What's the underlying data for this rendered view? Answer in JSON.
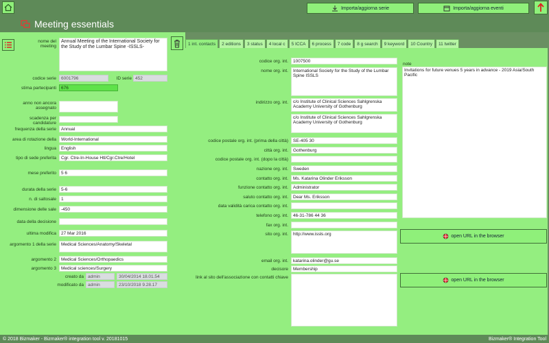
{
  "header": {
    "title": "Meeting essentials",
    "import_series": "Importa/aggiorna serie",
    "import_events": "Importa/aggiorna eventi"
  },
  "left": {
    "meeting_name_label": "nome del meeting",
    "meeting_name": "Annual Meeting of the International Society for the Study of the Lumbar Spine -ISSLS-",
    "series_code_label": "codice serie",
    "series_code": "6001796",
    "series_id_label": "ID serie",
    "series_id": "452",
    "estimate_label": "stima partecipanti",
    "estimate": "676",
    "year_not_assigned_label": "anno non ancora assegnato",
    "year_not_assigned": "",
    "candidature_label": "scadenza per candidature",
    "candidature": "",
    "frequency_label": "frequenza della serie",
    "frequency": "Annual",
    "rotation_label": "area di rotazione della",
    "rotation": "World-International",
    "language_label": "lingua",
    "language": "English",
    "venue_type_label": "tipo di sede preferita",
    "venue_type": "Cgr. Ctre-In-House Htl/Cgr.Ctre/Hotel",
    "month_label": "mese preferito",
    "month": "5 6",
    "duration_label": "durata della serie",
    "duration": "5-6",
    "halls_label": "n. di saltosale",
    "halls": "1",
    "hall_size_label": "dimensione delle sale",
    "hall_size": "-450",
    "decision_date_label": "data della decisione",
    "decision_date": "",
    "last_modified_label": "ultima modifica",
    "last_modified": "27 Mar 2016",
    "topic1_label": "argomento 1 della serie",
    "topic1": "Medical Sciences/Anatomy/Skeletal",
    "topic2_label": "argomento 2",
    "topic2": "Medical Sciences/Orthopaedics",
    "topic3_label": "argomento 3",
    "topic3": "Medical sciences/Surgery",
    "created_label": "creato da",
    "created_by": "admin",
    "created_at": "30/04/2014 18.01.54",
    "modified_label": "modificato da",
    "modified_by": "admin",
    "modified_at": "23/10/2018 9.28.17"
  },
  "tabs": [
    "1 int. contacts",
    "2 editions",
    "3 status",
    "4 local c",
    "5 ICCA",
    "6 process",
    "7 code",
    "8 g search",
    "9 keyword",
    "10 Country",
    "11 twitter"
  ],
  "contacts": {
    "org_code_label": "codice org. int.",
    "org_code": "1007500",
    "org_name_label": "nome org. int.",
    "org_name": "International Society for the Study of the Lumbar Spine ISSLS",
    "address_label": "indirizzo org. int.",
    "address1": "c/o Institute of Clinical Sciences Sahlgrenska Academy University of Gothenburg",
    "address2": "c/o Institute of Clinical Sciences Sahlgrenska Academy University of Gothenburg",
    "zip_before_label": "codice postale org. int. (prima della città)",
    "zip_before": "SE-405 30",
    "city_label": "città org. int.",
    "city": "Gothenburg",
    "zip_after_label": "codice postale org. int. (dopo la città)",
    "zip_after": "",
    "country_label": "nazione org. int.",
    "country": "Sweden",
    "contact_label": "contatto org. int.",
    "contact": "Ms. Katarina Olinder Eriksson",
    "role_label": "funzione contatto org. int.",
    "role": "Administrator",
    "greeting_label": "saluto contatto org. int.",
    "greeting": "Dear Ms. Eriksson",
    "validity_label": "data validità carica contatto org. int.",
    "validity": "",
    "phone_label": "telefono org. int.",
    "phone": "46-31-786 44 36",
    "fax_label": "fax org. int.",
    "fax": "",
    "site_label": "sito org. int.",
    "site": "http://www.issls.org",
    "email_label": "email org. int.",
    "email": "katarina.olinder@gu.se",
    "decision_label": "decisore",
    "decision": "Membership",
    "link_label": "link al sito dell'associazione con contatti chiave",
    "link": "",
    "note_label": "note",
    "note": "Invitations for future venues 5 years in advance - 2019 Asia/South Pacific",
    "open_url": "open URL in the browser",
    "open_url2": "open URL in the browser"
  },
  "footer": {
    "left": "© 2018 Bizmaker - Bizmaker® integration tool v. 20181015",
    "right": "Bizmaker® Integration Tool"
  }
}
